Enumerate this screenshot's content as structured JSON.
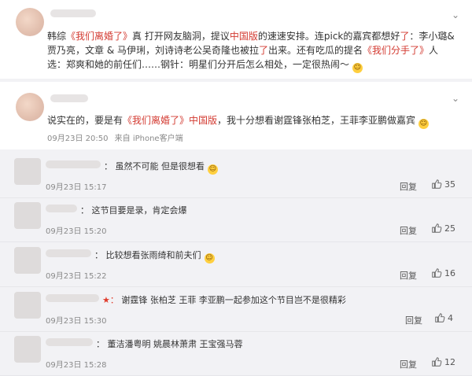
{
  "post1": {
    "segments": [
      {
        "t": "韩综",
        "hl": false
      },
      {
        "t": "《我们离婚了》",
        "hl": true
      },
      {
        "t": "真 打开网友脑洞，提议",
        "hl": false
      },
      {
        "t": "中国版",
        "hl": true
      },
      {
        "t": "的速速安排。连pick的嘉宾都想好",
        "hl": false
      },
      {
        "t": "了",
        "hl": true
      },
      {
        "t": "：李小璐&贾乃亮，文章 & 马伊琍，刘诗诗老公吴奇隆也被拉",
        "hl": false
      },
      {
        "t": "了",
        "hl": true
      },
      {
        "t": "出来。还有吃瓜的提名",
        "hl": false
      },
      {
        "t": "《我们分手了》",
        "hl": true
      },
      {
        "t": "人选：郑爽和她的前任们……钢针：明星们分开后怎么相处，一定很热闹～",
        "hl": false
      }
    ],
    "emoji": "😄",
    "chevron_icon": "chevron-down-icon"
  },
  "post2": {
    "segments": [
      {
        "t": "说实在的，要是有",
        "hl": false
      },
      {
        "t": "《我们离婚了》中国版",
        "hl": true
      },
      {
        "t": "，我十分想看谢霆锋张柏芝，王菲李亚鹏做嘉宾",
        "hl": false
      }
    ],
    "emoji": "😉",
    "time": "09月23日 20:50",
    "source": "来自 iPhone客户端",
    "chevron_icon": "chevron-down-icon"
  },
  "replies": [
    {
      "prefix": "：",
      "text": "虽然不可能 但是很想看",
      "emoji": "😄",
      "time": "09月23日 15:17",
      "reply": "回复",
      "likes": "35"
    },
    {
      "prefix": "：",
      "text": "这节目要是录，肯定会爆",
      "emoji": "",
      "time": "09月23日 15:20",
      "reply": "回复",
      "likes": "25"
    },
    {
      "prefix": "：",
      "text": "比较想看张雨绮和前夫们",
      "emoji": "😊",
      "time": "09月23日 15:22",
      "reply": "回复",
      "likes": "16"
    },
    {
      "prefix": "★：",
      "text": "谢霆锋 张柏芝 王菲 李亚鹏一起参加这个节目岂不是很精彩",
      "emoji": "",
      "time": "09月23日 15:30",
      "reply": "回复",
      "likes": "4"
    },
    {
      "prefix": "：",
      "text": "董洁潘粤明 姚晨林萧肃 王宝强马蓉",
      "emoji": "",
      "time": "09月23日 15:28",
      "reply": "回复",
      "likes": "12"
    }
  ]
}
